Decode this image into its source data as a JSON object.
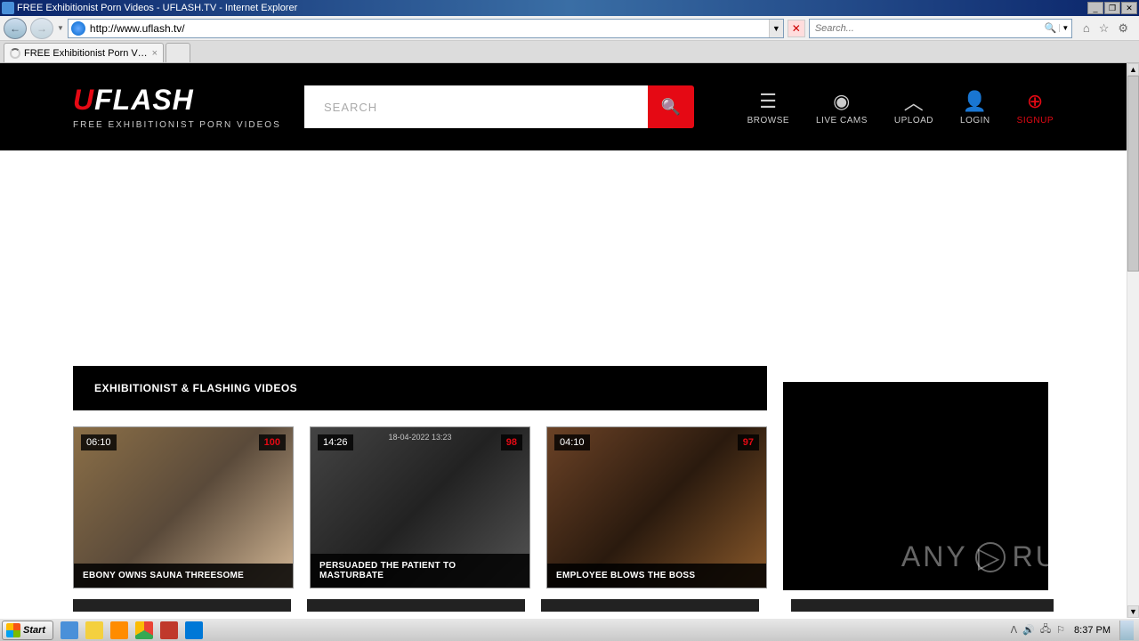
{
  "window": {
    "title": "FREE Exhibitionist Porn Videos - UFLASH.TV - Internet Explorer",
    "url": "http://www.uflash.tv/",
    "tab_title": "FREE Exhibitionist Porn Video...",
    "search_placeholder": "Search..."
  },
  "site": {
    "logo_u": "U",
    "logo_rest": "FLASH",
    "tagline": "FREE EXHIBITIONIST PORN VIDEOS",
    "search_placeholder": "SEARCH",
    "nav": {
      "browse": "BROWSE",
      "livecams": "LIVE CAMS",
      "upload": "UPLOAD",
      "login": "LOGIN",
      "signup": "SIGNUP"
    },
    "section_title": "EXHIBITIONIST & FLASHING VIDEOS",
    "videos": [
      {
        "time": "06:10",
        "score": "100",
        "title": "EBONY OWNS SAUNA THREESOME",
        "overlay": ""
      },
      {
        "time": "14:26",
        "score": "98",
        "title": "PERSUADED THE PATIENT TO MASTURBATE",
        "overlay": "18-04-2022 13:23"
      },
      {
        "time": "04:10",
        "score": "97",
        "title": "EMPLOYEE BLOWS THE BOSS",
        "overlay": ""
      }
    ]
  },
  "watermark": {
    "a": "ANY",
    "b": "RUN"
  },
  "taskbar": {
    "start": "Start",
    "clock": "8:37 PM"
  }
}
